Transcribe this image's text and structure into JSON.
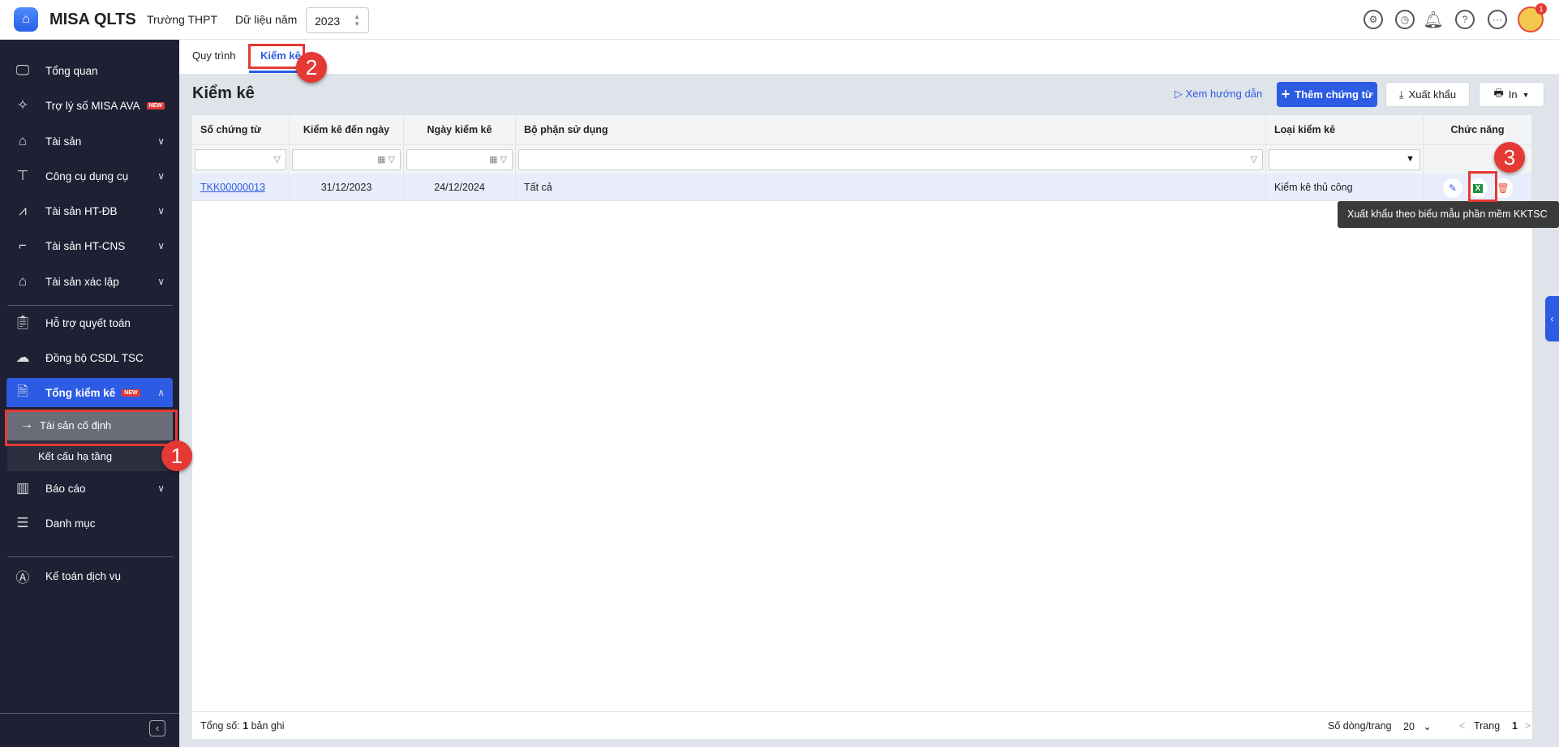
{
  "header": {
    "logo_icon": "house-icon",
    "app_name": "MISA QLTS",
    "unit": "Trường THPT",
    "year_label": "Dữ liệu năm",
    "year": "2023",
    "notification_count": "1",
    "icons": [
      "gear-icon",
      "alarm-icon",
      "bell-icon",
      "help-icon",
      "more-icon"
    ]
  },
  "sidebar": {
    "items": [
      {
        "label": "Tổng quan",
        "icon": "monitor-chart-icon"
      },
      {
        "label": "Trợ lý số MISA AVA",
        "icon": "sparkle-icon",
        "badge": "NEW"
      },
      {
        "label": "Tài sản",
        "icon": "car-house-icon"
      },
      {
        "label": "Công cụ dụng cụ",
        "icon": "paint-roller-icon"
      },
      {
        "label": "Tài sản HT-ĐB",
        "icon": "road-icon"
      },
      {
        "label": "Tài sản HT-CNS",
        "icon": "pipe-icon"
      },
      {
        "label": "Tài sản xác lập",
        "icon": "car-house-icon"
      },
      {
        "label": "Hỗ trợ quyết toán",
        "icon": "clipboard-icon"
      },
      {
        "label": "Đồng bộ CSDL TSC",
        "icon": "cloud-upload-icon"
      },
      {
        "label": "Tổng kiểm kê",
        "icon": "doc-check-icon",
        "badge": "NEW"
      },
      {
        "label": "Báo cáo",
        "icon": "bar-chart-icon"
      },
      {
        "label": "Danh mục",
        "icon": "list-icon"
      },
      {
        "label": "Kế toán dịch vụ",
        "icon": "logo-circle-icon"
      }
    ],
    "sub_items": [
      {
        "label": "Tài sản cố định",
        "arrow": "→"
      },
      {
        "label": "Kết cấu hạ tầng"
      }
    ]
  },
  "tabs": [
    {
      "label": "Quy trình"
    },
    {
      "label": "Kiểm kê",
      "active": true
    }
  ],
  "page": {
    "title": "Kiểm kê",
    "guide": "Xem hướng dẫn",
    "add": "Thêm chứng từ",
    "export": "Xuất khẩu",
    "print": "In"
  },
  "table": {
    "columns": [
      "Số chứng từ",
      "Kiểm kê đến ngày",
      "Ngày kiểm kê",
      "Bộ phận sử dụng",
      "Loại kiểm kê",
      "Chức năng"
    ],
    "rows": [
      {
        "doc_no": "TKK00000013",
        "to_date": "31/12/2023",
        "date": "24/12/2024",
        "dept": "Tất cả",
        "type": "Kiểm kê thủ công"
      }
    ],
    "footer": {
      "total_label": "Tổng số:",
      "total": "1",
      "total_unit": "bản ghi",
      "rows_per_page_label": "Số dòng/trang",
      "rows_per_page": "20",
      "page_label": "Trang",
      "page": "1"
    }
  },
  "tooltip": "Xuất khẩu theo biểu mẫu phần mềm KKTSC",
  "annotations": [
    "1",
    "2",
    "3"
  ],
  "colors": {
    "accent": "#2d5be3",
    "sidebar": "#1d2133",
    "annotation": "#e53935",
    "excel": "#1e8e3e",
    "delete": "#e8542f"
  }
}
